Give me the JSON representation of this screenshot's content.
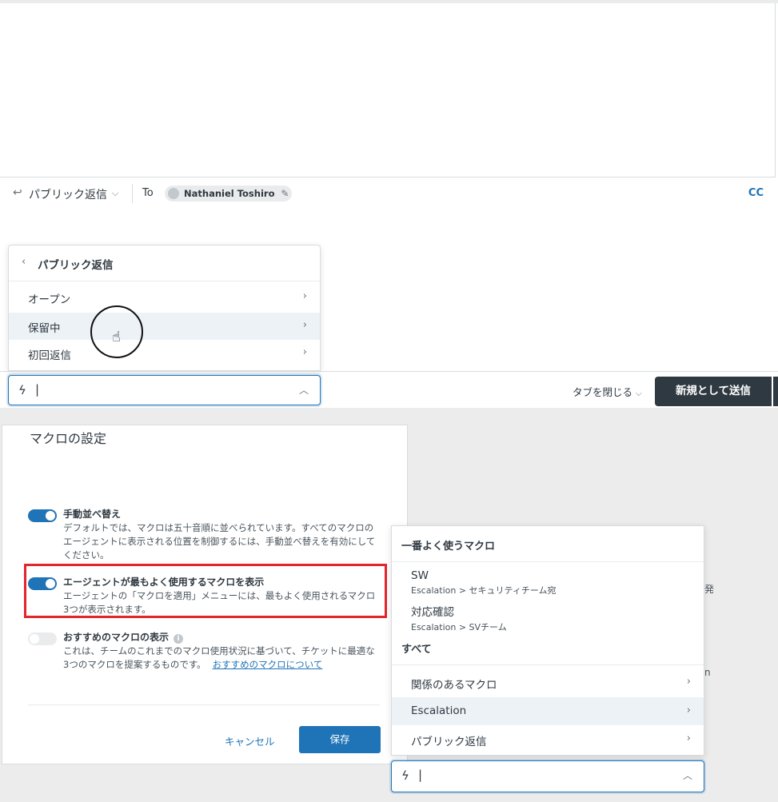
{
  "reply_bar": {
    "reply_type": "パブリック返信",
    "to_label": "To",
    "recipient": "Nathaniel Toshiro",
    "cc_label": "CC"
  },
  "top_menu": {
    "title": "パブリック返信",
    "items": [
      {
        "label": "オープン"
      },
      {
        "label": "保留中"
      },
      {
        "label": "初回返信"
      }
    ]
  },
  "top_macro_input": {
    "caret": "|"
  },
  "footer": {
    "close_tab_label": "タブを閉じる",
    "send_label": "新規として送信"
  },
  "settings": {
    "title": "マクロの設定",
    "manual_sort": {
      "title": "手動並べ替え",
      "desc": "デフォルトでは、マクロは五十音順に並べられています。すべてのマクロのエージェントに表示される位置を制御するには、手動並べ替えを有効にしてください。",
      "enabled": true
    },
    "most_used": {
      "title": "エージェントが最もよく使用するマクロを表示",
      "desc": "エージェントの「マクロを適用」メニューには、最もよく使用されるマクロ3つが表示されます。",
      "enabled": true
    },
    "suggested": {
      "title": "おすすめのマクロの表示",
      "desc": "これは、チームのこれまでのマクロ使用状況に基づいて、チケットに最適な3つのマクロを提案するものです。",
      "link": "おすすめのマクロについて",
      "enabled": false
    },
    "cancel_label": "キャンセル",
    "save_label": "保存"
  },
  "macro_panel": {
    "most_used_heading": "一番よく使うマクロ",
    "most_used": [
      {
        "name": "SW",
        "path": "Escalation > セキュリティチーム宛"
      },
      {
        "name": "対応確認",
        "path": "Escalation > SVチーム"
      }
    ],
    "all_heading": "すべて",
    "categories": [
      {
        "label": "関係のあるマクロ"
      },
      {
        "label": "Escalation"
      },
      {
        "label": "パブリック返信"
      }
    ]
  },
  "bottom_macro_input": {
    "caret": "|"
  },
  "edge_glyphs": [
    "発",
    "n"
  ]
}
